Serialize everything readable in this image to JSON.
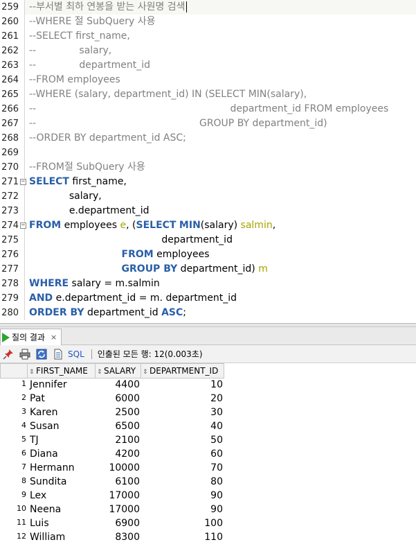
{
  "editor": {
    "lines": [
      {
        "num": "259",
        "fold": "",
        "current": true,
        "tokens": [
          {
            "t": "--부서별 최하 연봉을 받는 사원명 검색",
            "c": "com"
          }
        ],
        "caret": true
      },
      {
        "num": "260",
        "fold": "",
        "tokens": [
          {
            "t": "--WHERE 절 SubQuery 사용",
            "c": "com"
          }
        ]
      },
      {
        "num": "261",
        "fold": "",
        "tokens": [
          {
            "t": "--SELECT first_name,",
            "c": "com"
          }
        ]
      },
      {
        "num": "262",
        "fold": "",
        "tokens": [
          {
            "t": "--              salary,",
            "c": "com"
          }
        ]
      },
      {
        "num": "263",
        "fold": "",
        "tokens": [
          {
            "t": "--              department_id",
            "c": "com"
          }
        ]
      },
      {
        "num": "264",
        "fold": "",
        "tokens": [
          {
            "t": "--FROM employees",
            "c": "com"
          }
        ]
      },
      {
        "num": "265",
        "fold": "",
        "tokens": [
          {
            "t": "--WHERE (salary, department_id) IN (SELECT MIN(salary),",
            "c": "com"
          }
        ]
      },
      {
        "num": "266",
        "fold": "",
        "tokens": [
          {
            "t": "--                                                               department_id FROM employees",
            "c": "com"
          }
        ]
      },
      {
        "num": "267",
        "fold": "",
        "tokens": [
          {
            "t": "--                                                     GROUP BY department_id)",
            "c": "com"
          }
        ]
      },
      {
        "num": "268",
        "fold": "",
        "tokens": [
          {
            "t": "--ORDER BY department_id ASC;",
            "c": "com"
          }
        ]
      },
      {
        "num": "269",
        "fold": "",
        "tokens": []
      },
      {
        "num": "270",
        "fold": "",
        "tokens": [
          {
            "t": "--FROM절 SubQuery 사용",
            "c": "com"
          }
        ]
      },
      {
        "num": "271",
        "fold": "⊟",
        "tokens": [
          {
            "t": "SELECT",
            "c": "kw"
          },
          {
            "t": " first_name,",
            "c": "id"
          }
        ]
      },
      {
        "num": "272",
        "fold": "",
        "tokens": [
          {
            "t": "             salary,",
            "c": "id"
          }
        ]
      },
      {
        "num": "273",
        "fold": "",
        "tokens": [
          {
            "t": "             e.department_id",
            "c": "id"
          }
        ]
      },
      {
        "num": "274",
        "fold": "⊟",
        "tokens": [
          {
            "t": "FROM",
            "c": "kw"
          },
          {
            "t": " employees ",
            "c": "id"
          },
          {
            "t": "e",
            "c": "al"
          },
          {
            "t": ", (",
            "c": "id"
          },
          {
            "t": "SELECT",
            "c": "kw"
          },
          {
            "t": " ",
            "c": "id"
          },
          {
            "t": "MIN",
            "c": "fn"
          },
          {
            "t": "(salary) ",
            "c": "id"
          },
          {
            "t": "salmin",
            "c": "al"
          },
          {
            "t": ",",
            "c": "id"
          }
        ]
      },
      {
        "num": "275",
        "fold": "",
        "tokens": [
          {
            "t": "                                           department_id",
            "c": "id"
          }
        ]
      },
      {
        "num": "276",
        "fold": "",
        "tokens": [
          {
            "t": "                              ",
            "c": "id"
          },
          {
            "t": "FROM",
            "c": "kw"
          },
          {
            "t": " employees",
            "c": "id"
          }
        ]
      },
      {
        "num": "277",
        "fold": "",
        "tokens": [
          {
            "t": "                              ",
            "c": "id"
          },
          {
            "t": "GROUP BY",
            "c": "kw"
          },
          {
            "t": " department_id) ",
            "c": "id"
          },
          {
            "t": "m",
            "c": "al"
          }
        ]
      },
      {
        "num": "278",
        "fold": "",
        "tokens": [
          {
            "t": "WHERE",
            "c": "kw"
          },
          {
            "t": " salary = m.salmin",
            "c": "id"
          }
        ]
      },
      {
        "num": "279",
        "fold": "",
        "tokens": [
          {
            "t": "AND",
            "c": "kw"
          },
          {
            "t": " e.department_id = m. department_id",
            "c": "id"
          }
        ]
      },
      {
        "num": "280",
        "fold": "",
        "tokens": [
          {
            "t": "ORDER BY",
            "c": "kw"
          },
          {
            "t": " department_id ",
            "c": "id"
          },
          {
            "t": "ASC",
            "c": "kw"
          },
          {
            "t": ";",
            "c": "id"
          }
        ]
      }
    ]
  },
  "results": {
    "tab_label": "질의 결과",
    "tab_close": "×",
    "toolbar": {
      "sql_label": "SQL",
      "separator": "|",
      "status": "인출된 모든 행: 12(0.003초)"
    },
    "columns": [
      "FIRST_NAME",
      "SALARY",
      "DEPARTMENT_ID"
    ],
    "rows": [
      {
        "n": "1",
        "first_name": "Jennifer",
        "salary": "4400",
        "department_id": "10"
      },
      {
        "n": "2",
        "first_name": "Pat",
        "salary": "6000",
        "department_id": "20"
      },
      {
        "n": "3",
        "first_name": "Karen",
        "salary": "2500",
        "department_id": "30"
      },
      {
        "n": "4",
        "first_name": "Susan",
        "salary": "6500",
        "department_id": "40"
      },
      {
        "n": "5",
        "first_name": "TJ",
        "salary": "2100",
        "department_id": "50"
      },
      {
        "n": "6",
        "first_name": "Diana",
        "salary": "4200",
        "department_id": "60"
      },
      {
        "n": "7",
        "first_name": "Hermann",
        "salary": "10000",
        "department_id": "70"
      },
      {
        "n": "8",
        "first_name": "Sundita",
        "salary": "6100",
        "department_id": "80"
      },
      {
        "n": "9",
        "first_name": "Lex",
        "salary": "17000",
        "department_id": "90"
      },
      {
        "n": "10",
        "first_name": "Neena",
        "salary": "17000",
        "department_id": "90"
      },
      {
        "n": "11",
        "first_name": "Luis",
        "salary": "6900",
        "department_id": "100"
      },
      {
        "n": "12",
        "first_name": "William",
        "salary": "8300",
        "department_id": "110"
      }
    ]
  },
  "icons": {
    "pin": "pin-icon",
    "print": "print-icon",
    "refresh": "refresh-icon",
    "sql": "sql-icon",
    "run": "run-query-icon"
  },
  "colors": {
    "keyword": "#2a5fa8",
    "comment": "#808080",
    "alias": "#a5a500",
    "link": "#1a56c8",
    "run_icon": "#2ea52e"
  }
}
